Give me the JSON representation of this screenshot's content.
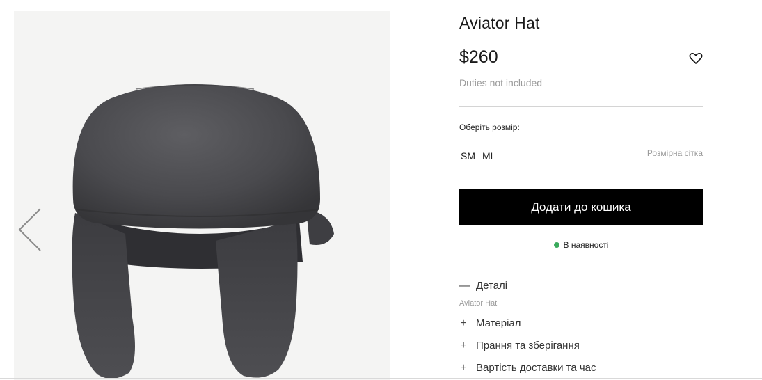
{
  "product": {
    "title": "Aviator Hat",
    "price": "$260",
    "duties_note": "Duties not included",
    "wishlist_icon": "heart-icon"
  },
  "gallery": {
    "image": "grey-felt-aviator-hat",
    "prev_icon": "chevron-left-icon",
    "background_color": "#f4f4f3"
  },
  "size": {
    "label": "Оберіть розмір:",
    "options": [
      "SM",
      "ML"
    ],
    "selected": "SM",
    "chart_link": "Розмірна сітка"
  },
  "add_to_cart_label": "Додати до кошика",
  "stock": {
    "text": "В наявності",
    "dot_color": "#3aaa5c"
  },
  "accordion": [
    {
      "sign": "—",
      "label": "Деталі",
      "expanded": true,
      "content": "Aviator Hat"
    },
    {
      "sign": "+",
      "label": "Матеріал",
      "expanded": false
    },
    {
      "sign": "+",
      "label": "Прання та зберігання",
      "expanded": false
    },
    {
      "sign": "+",
      "label": "Вартість доставки та час",
      "expanded": false
    }
  ]
}
